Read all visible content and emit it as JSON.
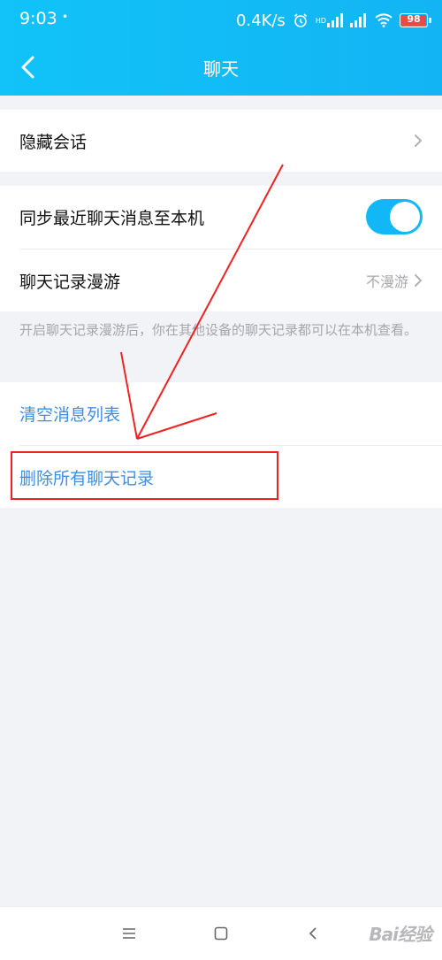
{
  "status_bar": {
    "time": "9:03",
    "notification": "•",
    "network_speed": "0.4K/s",
    "hd_badge": "HD",
    "battery_level": "98"
  },
  "header": {
    "title": "聊天"
  },
  "settings": {
    "hidden_chats": {
      "label": "隐藏会话"
    },
    "sync_recent": {
      "label": "同步最近聊天消息至本机",
      "enabled": true
    },
    "roaming": {
      "label": "聊天记录漫游",
      "value": "不漫游"
    },
    "roaming_hint": "开启聊天记录漫游后，你在其他设备的聊天记录都可以在本机查看。",
    "clear_message_list": {
      "label": "清空消息列表"
    },
    "delete_all_history": {
      "label": "删除所有聊天记录"
    }
  },
  "colors": {
    "header": "#12b7f5",
    "accent_blue": "#3d8ee6",
    "annotation_red": "#e22222"
  },
  "watermark": "Bai经验"
}
